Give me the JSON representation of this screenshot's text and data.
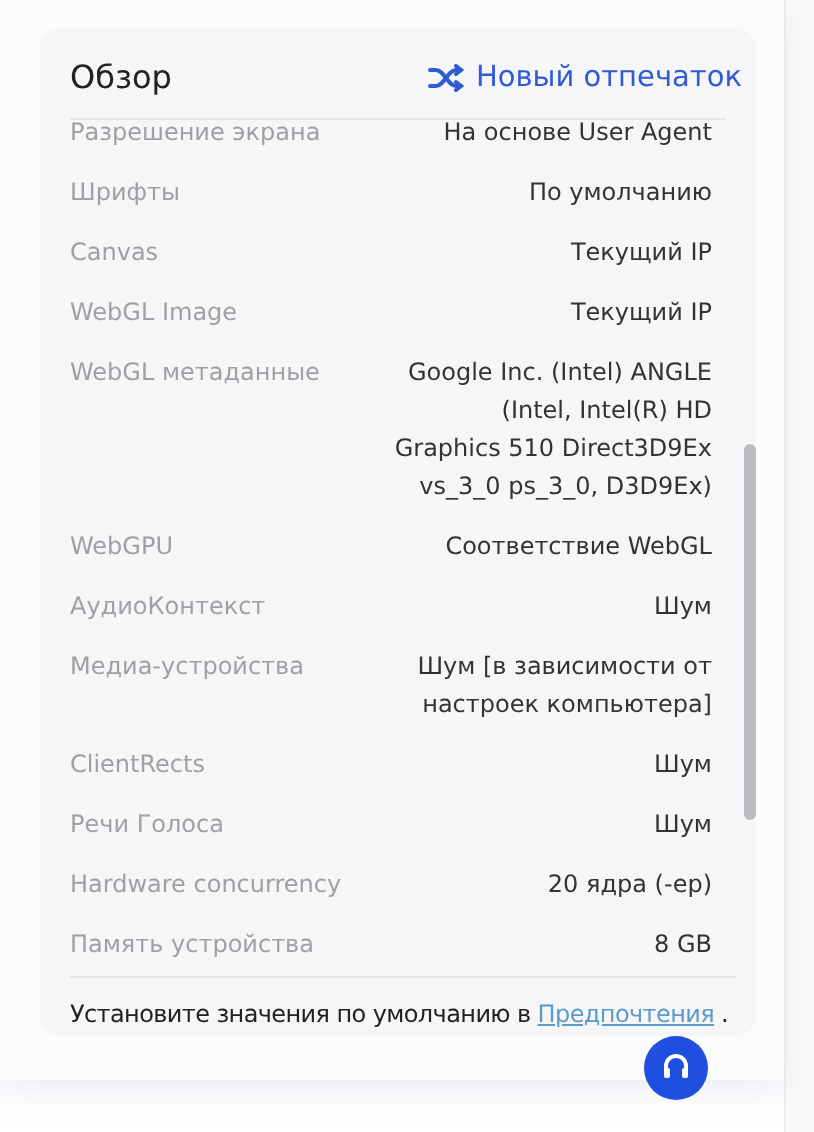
{
  "header": {
    "title": "Обзор",
    "action": "Новый отпечаток"
  },
  "rows": [
    {
      "label": "Разрешение экрана",
      "value": "На основе User Agent"
    },
    {
      "label": "Шрифты",
      "value": "По умолчанию"
    },
    {
      "label": "Canvas",
      "value": "Текущий IP"
    },
    {
      "label": "WebGL Image",
      "value": "Текущий IP"
    },
    {
      "label": "WebGL метаданные",
      "value": "Google Inc. (Intel) ANGLE (Intel, Intel(R) HD Graphics 510 Direct3D9Ex vs_3_0 ps_3_0, D3D9Ex)"
    },
    {
      "label": "WebGPU",
      "value": "Соответствие WebGL"
    },
    {
      "label": "АудиоКонтекст",
      "value": "Шум"
    },
    {
      "label": "Медиа-устройства",
      "value": "Шум [в зависимости от настроек компьютера]"
    },
    {
      "label": "ClientRects",
      "value": "Шум"
    },
    {
      "label": "Речи Голоса",
      "value": "Шум"
    },
    {
      "label": "Hardware concurrency",
      "value": "20 ядра (-ep)"
    },
    {
      "label": "Память устройства",
      "value": "8 GB"
    }
  ],
  "footer": {
    "text": "Установите значения по умолчанию в",
    "link": "Предпочтения",
    "end": "."
  }
}
